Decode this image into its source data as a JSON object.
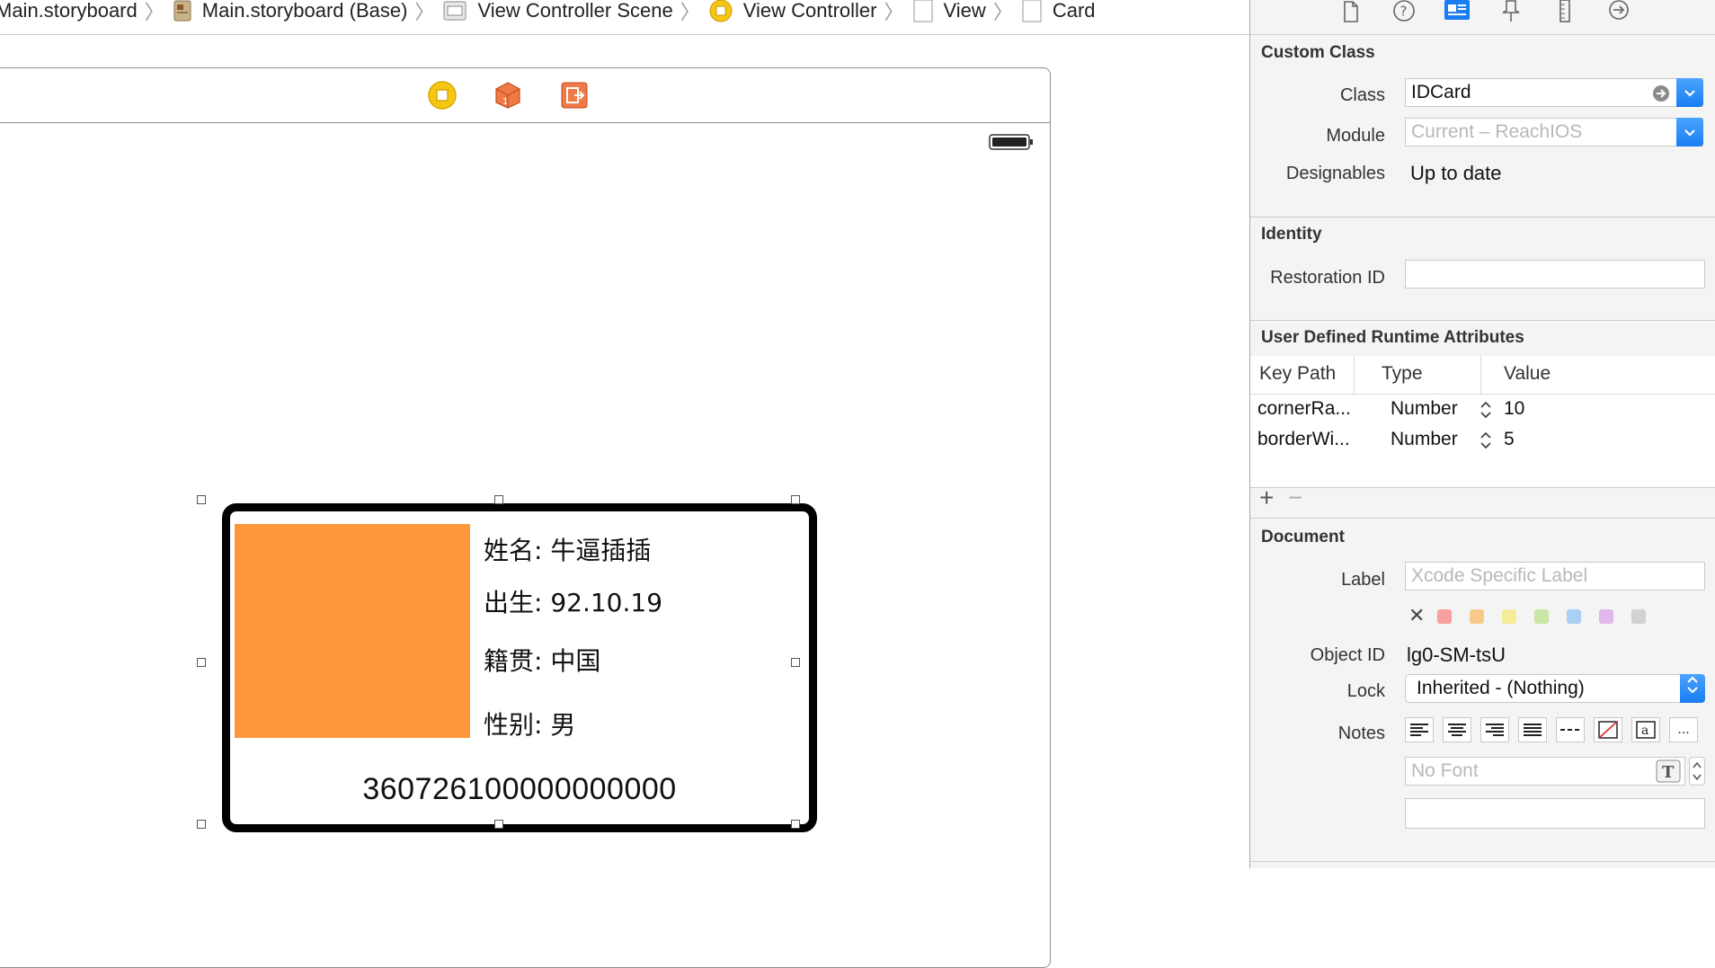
{
  "jumpbar": {
    "items": [
      {
        "label": "Main.storyboard",
        "icon": "storyboard-icon"
      },
      {
        "label": "Main.storyboard (Base)",
        "icon": "storyboard-base-icon"
      },
      {
        "label": "View Controller Scene",
        "icon": "scene-icon"
      },
      {
        "label": "View Controller",
        "icon": "view-controller-icon"
      },
      {
        "label": "View",
        "icon": "view-icon"
      },
      {
        "label": "Card",
        "icon": "view-icon"
      }
    ]
  },
  "card": {
    "name_line": "姓名: 牛逼插插",
    "birth_line": "出生: 92.10.19",
    "origin_line": "籍贯: 中国",
    "gender_line": "性别: 男",
    "id_number": "360726100000000000",
    "photo_color": "#fe973b"
  },
  "inspector": {
    "custom_class": {
      "title": "Custom Class",
      "class_label": "Class",
      "class_value": "IDCard",
      "module_label": "Module",
      "module_placeholder": "Current – ReachIOS",
      "designables_label": "Designables",
      "designables_value": "Up to date"
    },
    "identity": {
      "title": "Identity",
      "restoration_label": "Restoration ID",
      "restoration_value": ""
    },
    "udra": {
      "title": "User Defined Runtime Attributes",
      "columns": [
        "Key Path",
        "Type",
        "Value"
      ],
      "rows": [
        {
          "key": "cornerRa...",
          "type": "Number",
          "value": "10"
        },
        {
          "key": "borderWi...",
          "type": "Number",
          "value": "5"
        }
      ],
      "add": "+",
      "remove": "−"
    },
    "document": {
      "title": "Document",
      "label_label": "Label",
      "label_placeholder": "Xcode Specific Label",
      "clear": "✕",
      "object_id_label": "Object ID",
      "object_id_value": "lg0-SM-tsU",
      "lock_label": "Lock",
      "lock_value": "Inherited - (Nothing)",
      "notes_label": "Notes",
      "notes_more": "...",
      "font_placeholder": "No Font",
      "swatch_colors": [
        "#f8a0a0",
        "#f9c98c",
        "#f4ec98",
        "#c9e6a6",
        "#a8d0f4",
        "#e0b8ec",
        "#d2d2d2"
      ]
    }
  },
  "colors": {
    "accent": "#1a7ef2",
    "card_border": "#000000"
  }
}
